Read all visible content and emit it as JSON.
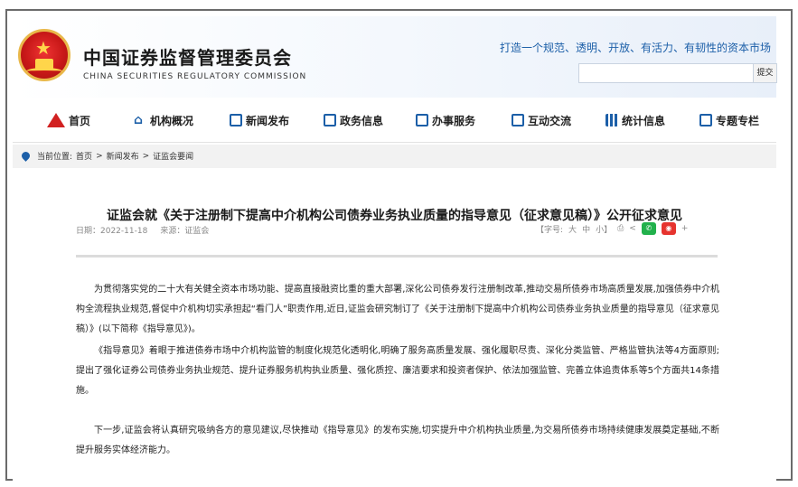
{
  "header": {
    "org_name_cn": "中国证券监督管理委员会",
    "org_name_en": "CHINA SECURITIES REGULATORY COMMISSION",
    "slogan": "打造一个规范、透明、开放、有活力、有韧性的资本市场",
    "search": {
      "placeholder": "",
      "button_label": "提交"
    }
  },
  "nav": {
    "items": [
      {
        "label": "首页",
        "icon": "home-icon"
      },
      {
        "label": "机构概况",
        "icon": "building-icon"
      },
      {
        "label": "新闻发布",
        "icon": "news-icon"
      },
      {
        "label": "政务信息",
        "icon": "monitor-icon"
      },
      {
        "label": "办事服务",
        "icon": "service-icon"
      },
      {
        "label": "互动交流",
        "icon": "chat-icon"
      },
      {
        "label": "统计信息",
        "icon": "bar-chart-icon"
      },
      {
        "label": "专题专栏",
        "icon": "document-icon"
      }
    ]
  },
  "breadcrumb": {
    "prefix": "当前位置:",
    "items": [
      "首页",
      "新闻发布",
      "证监会要闻"
    ],
    "separator": ">"
  },
  "article": {
    "title": "证监会就《关于注册制下提高中介机构公司债券业务执业质量的指导意见（征求意见稿）》公开征求意见",
    "date": "日期：2022-11-18",
    "source": "来源：证监会",
    "font_size_label": "【字号:",
    "font_large": "大",
    "font_medium": "中",
    "font_small": "小】",
    "share_plus": "+",
    "paragraphs": [
      "为贯彻落实党的二十大有关健全资本市场功能、提高直接融资比重的重大部署,深化公司债券发行注册制改革,推动交易所债券市场高质量发展,加强债券中介机构全流程执业规范,督促中介机构切实承担起“看门人”职责作用,近日,证监会研究制订了《关于注册制下提高中介机构公司债券业务执业质量的指导意见（征求意见稿）》(以下简称《指导意见》)。",
      "《指导意见》着眼于推进债券市场中介机构监管的制度化规范化透明化,明确了服务高质量发展、强化履职尽责、深化分类监管、严格监管执法等4方面原则;提出了强化证券公司债券业务执业规范、提升证券服务机构执业质量、强化质控、廉洁要求和投资者保护、依法加强监管、完善立体追责体系等5个方面共14条措施。",
      "下一步,证监会将认真研究吸纳各方的意见建议,尽快推动《指导意见》的发布实施,切实提升中介机构执业质量,为交易所债券市场持续健康发展奠定基础,不断提升服务实体经济能力。"
    ]
  }
}
